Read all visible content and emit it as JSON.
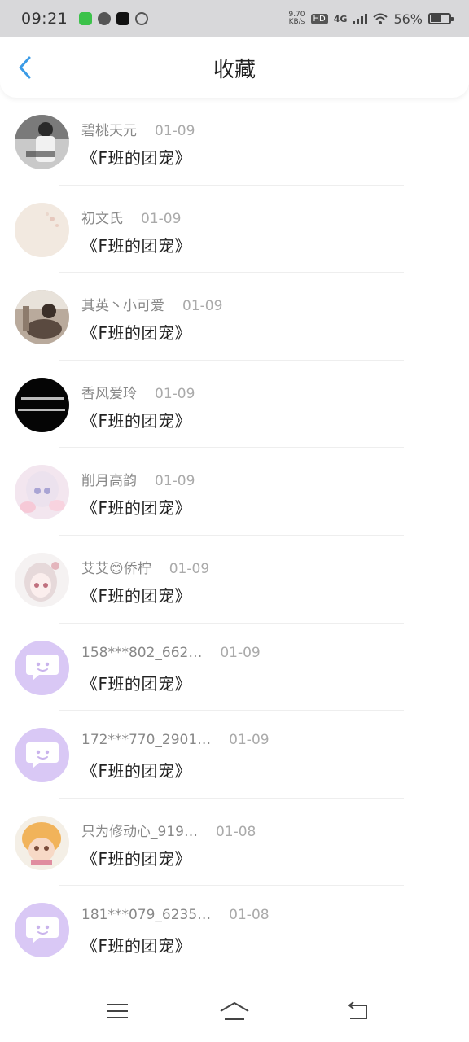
{
  "status_bar": {
    "time": "09:21",
    "net_speed_value": "9.70",
    "net_speed_unit": "KB/s",
    "hd": "HD",
    "signal": "4G",
    "battery": "56%",
    "battery_level": 0.56
  },
  "header": {
    "title": "收藏",
    "back_icon": "chevron-left-icon",
    "accent": "#3b9be6"
  },
  "items": [
    {
      "name": "碧桃天元",
      "date": "01-09",
      "title": "《F班的团宠》",
      "avatar": "photo"
    },
    {
      "name": "初文氏",
      "date": "01-09",
      "title": "《F班的团宠》",
      "avatar": "photo"
    },
    {
      "name": "其英丶小可爱",
      "date": "01-09",
      "title": "《F班的团宠》",
      "avatar": "photo"
    },
    {
      "name": "香风爱玲",
      "date": "01-09",
      "title": "《F班的团宠》",
      "avatar": "photo"
    },
    {
      "name": "削月高韵",
      "date": "01-09",
      "title": "《F班的团宠》",
      "avatar": "photo"
    },
    {
      "name": "艾艾😊侨柠",
      "date": "01-09",
      "title": "《F班的团宠》",
      "avatar": "photo"
    },
    {
      "name": "158***802_662…",
      "date": "01-09",
      "title": "《F班的团宠》",
      "avatar": "chat-bubble-icon"
    },
    {
      "name": "172***770_2901…",
      "date": "01-09",
      "title": "《F班的团宠》",
      "avatar": "chat-bubble-icon"
    },
    {
      "name": "只为修动心_919…",
      "date": "01-08",
      "title": "《F班的团宠》",
      "avatar": "photo"
    },
    {
      "name": "181***079_6235…",
      "date": "01-08",
      "title": "《F班的团宠》",
      "avatar": "chat-bubble-icon"
    }
  ],
  "nav_bar": {
    "menu_icon": "menu-icon",
    "home_icon": "home-icon",
    "back_icon": "back-arrow-icon"
  }
}
